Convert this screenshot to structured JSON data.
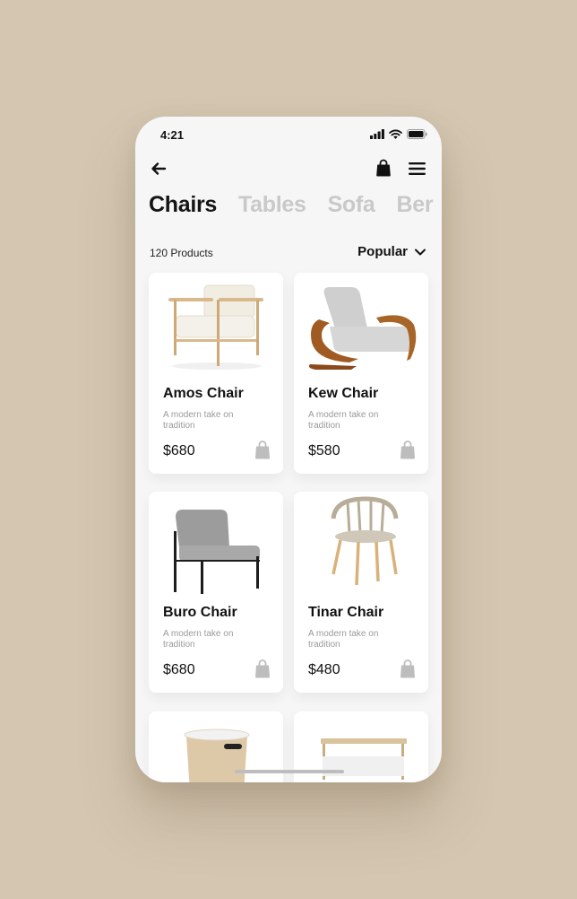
{
  "status": {
    "time": "4:21"
  },
  "tabs": [
    "Chairs",
    "Tables",
    "Sofa",
    "Ber"
  ],
  "meta": {
    "count": "120 Products",
    "sort": "Popular"
  },
  "products": [
    {
      "name": "Amos Chair",
      "desc": "A modern take on tradition",
      "price": "$680"
    },
    {
      "name": "Kew Chair",
      "desc": "A modern take on tradition",
      "price": "$580"
    },
    {
      "name": "Buro Chair",
      "desc": "A modern take on tradition",
      "price": "$680"
    },
    {
      "name": "Tinar Chair",
      "desc": "A modern take on tradition",
      "price": "$480"
    }
  ],
  "colors": {
    "background": "#d4c6b1",
    "active_tab": "#151515",
    "inactive_tab": "#c9c9c9",
    "cart_icon": "#bdbdbd"
  }
}
